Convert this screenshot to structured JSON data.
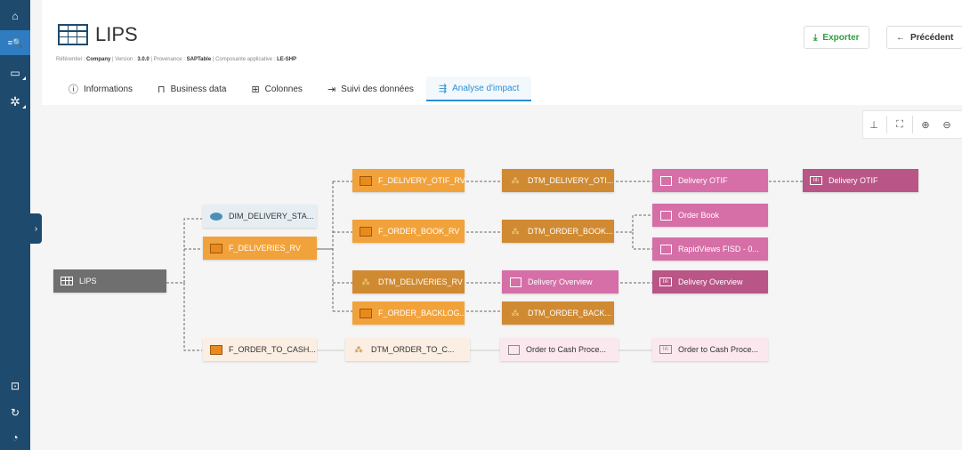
{
  "rail": {
    "items": [
      {
        "icon": "home-icon",
        "glyph": "⌂"
      },
      {
        "icon": "search-list-icon",
        "glyph": "≡🔍"
      },
      {
        "icon": "card-icon",
        "glyph": "▭"
      },
      {
        "icon": "network-icon",
        "glyph": "✲"
      },
      {
        "icon": "import-icon",
        "glyph": "⊡"
      },
      {
        "icon": "refresh-icon",
        "glyph": "↻"
      },
      {
        "icon": "gauge-icon",
        "glyph": "◔"
      }
    ],
    "expander_glyph": "›"
  },
  "header": {
    "title": "LIPS",
    "meta": {
      "referentiel_label": "Référentiel :",
      "referentiel_value": "Company",
      "version_label": "Version :",
      "version_value": "3.0.0",
      "provenance_label": "Provenance :",
      "provenance_value": "SAPTable",
      "composante_label": "Composante applicative :",
      "composante_value": "LE-SHP",
      "sep": "|"
    },
    "export_label": "Exporter",
    "prev_label": "Précédent",
    "tabs": [
      {
        "label": "Informations",
        "icon": "info-icon",
        "glyph": "ⓘ"
      },
      {
        "label": "Business data",
        "icon": "briefcase-icon",
        "glyph": "⊓"
      },
      {
        "label": "Colonnes",
        "icon": "grid-icon",
        "glyph": "⊞"
      },
      {
        "label": "Suivi des données",
        "icon": "lineage-icon",
        "glyph": "⇥"
      },
      {
        "label": "Analyse d'impact",
        "icon": "impact-icon",
        "glyph": "⇶"
      }
    ],
    "active_tab": 4
  },
  "graph": {
    "nodes": [
      {
        "id": "lips",
        "label": "LIPS",
        "kind": "table",
        "style": "gray"
      },
      {
        "id": "dim_delivery",
        "label": "DIM_DELIVERY_STA...",
        "kind": "db",
        "style": "lightblue"
      },
      {
        "id": "f_deliveries",
        "label": "F_DELIVERIES_RV",
        "kind": "box",
        "style": "orange"
      },
      {
        "id": "f_order_to_cash",
        "label": "F_ORDER_TO_CASH...",
        "kind": "box",
        "style": "cream"
      },
      {
        "id": "f_delivery_otif",
        "label": "F_DELIVERY_OTIF_RV",
        "kind": "box",
        "style": "orange"
      },
      {
        "id": "f_order_book",
        "label": "F_ORDER_BOOK_RV",
        "kind": "box",
        "style": "orange"
      },
      {
        "id": "dtm_deliveries",
        "label": "DTM_DELIVERIES_RV",
        "kind": "dtm",
        "style": "brown"
      },
      {
        "id": "f_order_backlog",
        "label": "F_ORDER_BACKLOG...",
        "kind": "box",
        "style": "orange"
      },
      {
        "id": "dtm_order_to_cash",
        "label": "DTM_ORDER_TO_C...",
        "kind": "dtm",
        "style": "cream"
      },
      {
        "id": "dtm_delivery_otif",
        "label": "DTM_DELIVERY_OTI...",
        "kind": "dtm",
        "style": "brown"
      },
      {
        "id": "dtm_order_book",
        "label": "DTM_ORDER_BOOK...",
        "kind": "dtm",
        "style": "brown"
      },
      {
        "id": "delivery_overview_r",
        "label": "Delivery Overview",
        "kind": "report",
        "style": "pink"
      },
      {
        "id": "dtm_order_back",
        "label": "DTM_ORDER_BACK...",
        "kind": "dtm",
        "style": "brown"
      },
      {
        "id": "order_to_cash_proc1",
        "label": "Order to Cash Proce...",
        "kind": "report",
        "style": "blush"
      },
      {
        "id": "delivery_otif_r",
        "label": "Delivery OTIF",
        "kind": "report",
        "style": "pink"
      },
      {
        "id": "order_book",
        "label": "Order Book",
        "kind": "report",
        "style": "pink"
      },
      {
        "id": "rapidviews",
        "label": "RapidViews FISD - 0...",
        "kind": "report",
        "style": "pink"
      },
      {
        "id": "delivery_overview_d",
        "label": "Delivery Overview",
        "kind": "dash",
        "style": "mauve"
      },
      {
        "id": "order_to_cash_proc2",
        "label": "Order to Cash Proce...",
        "kind": "dash",
        "style": "blush"
      },
      {
        "id": "delivery_otif_d",
        "label": "Delivery OTIF",
        "kind": "dash",
        "style": "mauve"
      }
    ]
  }
}
